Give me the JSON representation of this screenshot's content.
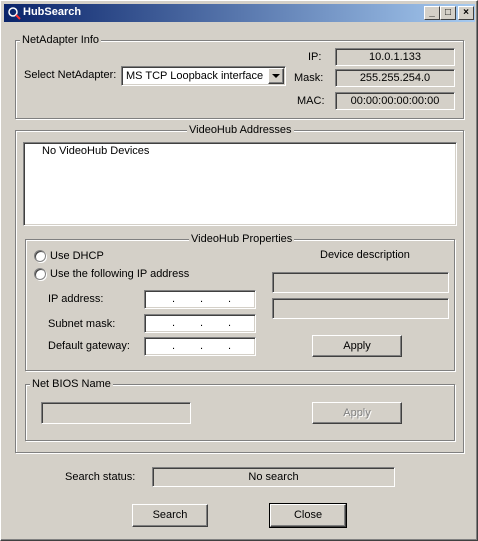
{
  "window": {
    "title": "HubSearch",
    "controls": {
      "minimize": "_",
      "maximize": "□",
      "close": "×"
    }
  },
  "net_adapter": {
    "group_title": "NetAdapter Info",
    "select_label": "Select NetAdapter:",
    "selected_adapter": "MS TCP Loopback interface",
    "ip_label": "IP:",
    "ip_value": "10.0.1.133",
    "mask_label": "Mask:",
    "mask_value": "255.255.254.0",
    "mac_label": "MAC:",
    "mac_value": "00:00:00:00:00:00"
  },
  "videohub_addresses": {
    "group_title": "VideoHub Addresses",
    "items": [
      "No VideoHub Devices"
    ]
  },
  "videohub_properties": {
    "group_title": "VideoHub Properties",
    "use_dhcp_label": "Use DHCP",
    "use_static_label": "Use the following IP address",
    "ip_address_label": "IP address:",
    "subnet_mask_label": "Subnet mask:",
    "default_gateway_label": "Default gateway:",
    "device_description_label": "Device description",
    "apply_label": "Apply"
  },
  "netbios": {
    "group_title": "Net BIOS Name",
    "apply_label": "Apply"
  },
  "status": {
    "label": "Search status:",
    "value": "No search"
  },
  "footer": {
    "search_label": "Search",
    "close_label": "Close"
  }
}
